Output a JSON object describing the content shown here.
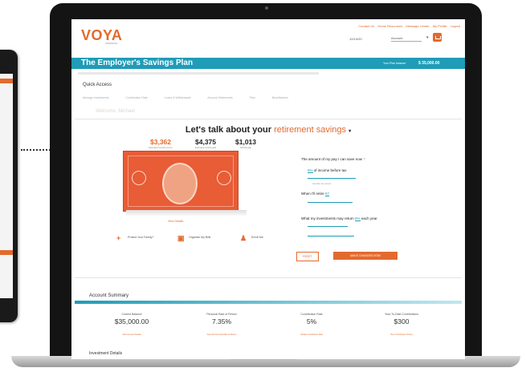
{
  "site": {
    "logo": "VOYA",
    "logo_sub": "FINANCIAL",
    "utility_links": [
      "Contact Us",
      "Home Resources",
      "Message Center",
      "My Profile",
      "Logout"
    ],
    "date": "12/14/20",
    "account_select": "Account",
    "plan_title": "The Employer's Savings Plan",
    "balance_label": "Your Plan balance",
    "balance_value": "$ 35,000.00"
  },
  "quick_links": {
    "title": "Quick Access",
    "items": [
      "Manage Investments",
      "Contribution Rate",
      "Loans & Withdrawals",
      "Account Statements",
      "Plan",
      "Beneficiaries"
    ]
  },
  "welcome": "Welcome, Michael",
  "retirement": {
    "headline_prefix": "Let's talk about your",
    "headline_accent": "retirement savings",
    "stats": [
      {
        "value": "$3,362",
        "label": "Estimated monthly income"
      },
      {
        "value": "$4,375",
        "label": "Estimated monthly goal"
      },
      {
        "value": "$1,013",
        "label": "Monthly gap"
      }
    ],
    "view_details": "View Details",
    "actions": [
      "Protect Your Family?",
      "Organize My Bills",
      "Enroll Me"
    ],
    "questions": {
      "q1": "The amount of my pay I can save now",
      "q1_value": "5%",
      "q1_suffix": "of income before tax",
      "q1_small": "Add after tax amount",
      "q2": "When I'll retire",
      "q2_value": "67",
      "q3": "What my investments may return",
      "q3_value": "6%",
      "q3_suffix": "each year"
    },
    "reset": "RESET",
    "make_change": "MAKE CHANGES NOW"
  },
  "account_summary": {
    "title": "Account Summary",
    "cols": [
      {
        "label": "Current Balance",
        "value": "$35,000.00",
        "link": "View Account Details"
      },
      {
        "label": "Personal Rate of Return",
        "value": "7.35%",
        "link": "View My Personal Rate of Return"
      },
      {
        "label": "Contribution Rate",
        "value": "5%",
        "link": "Update Contribution Rate"
      },
      {
        "label": "Year-To-Date Contributions",
        "value": "$300",
        "link": "View Contribution History"
      }
    ]
  },
  "investment_details": "Investment Details"
}
